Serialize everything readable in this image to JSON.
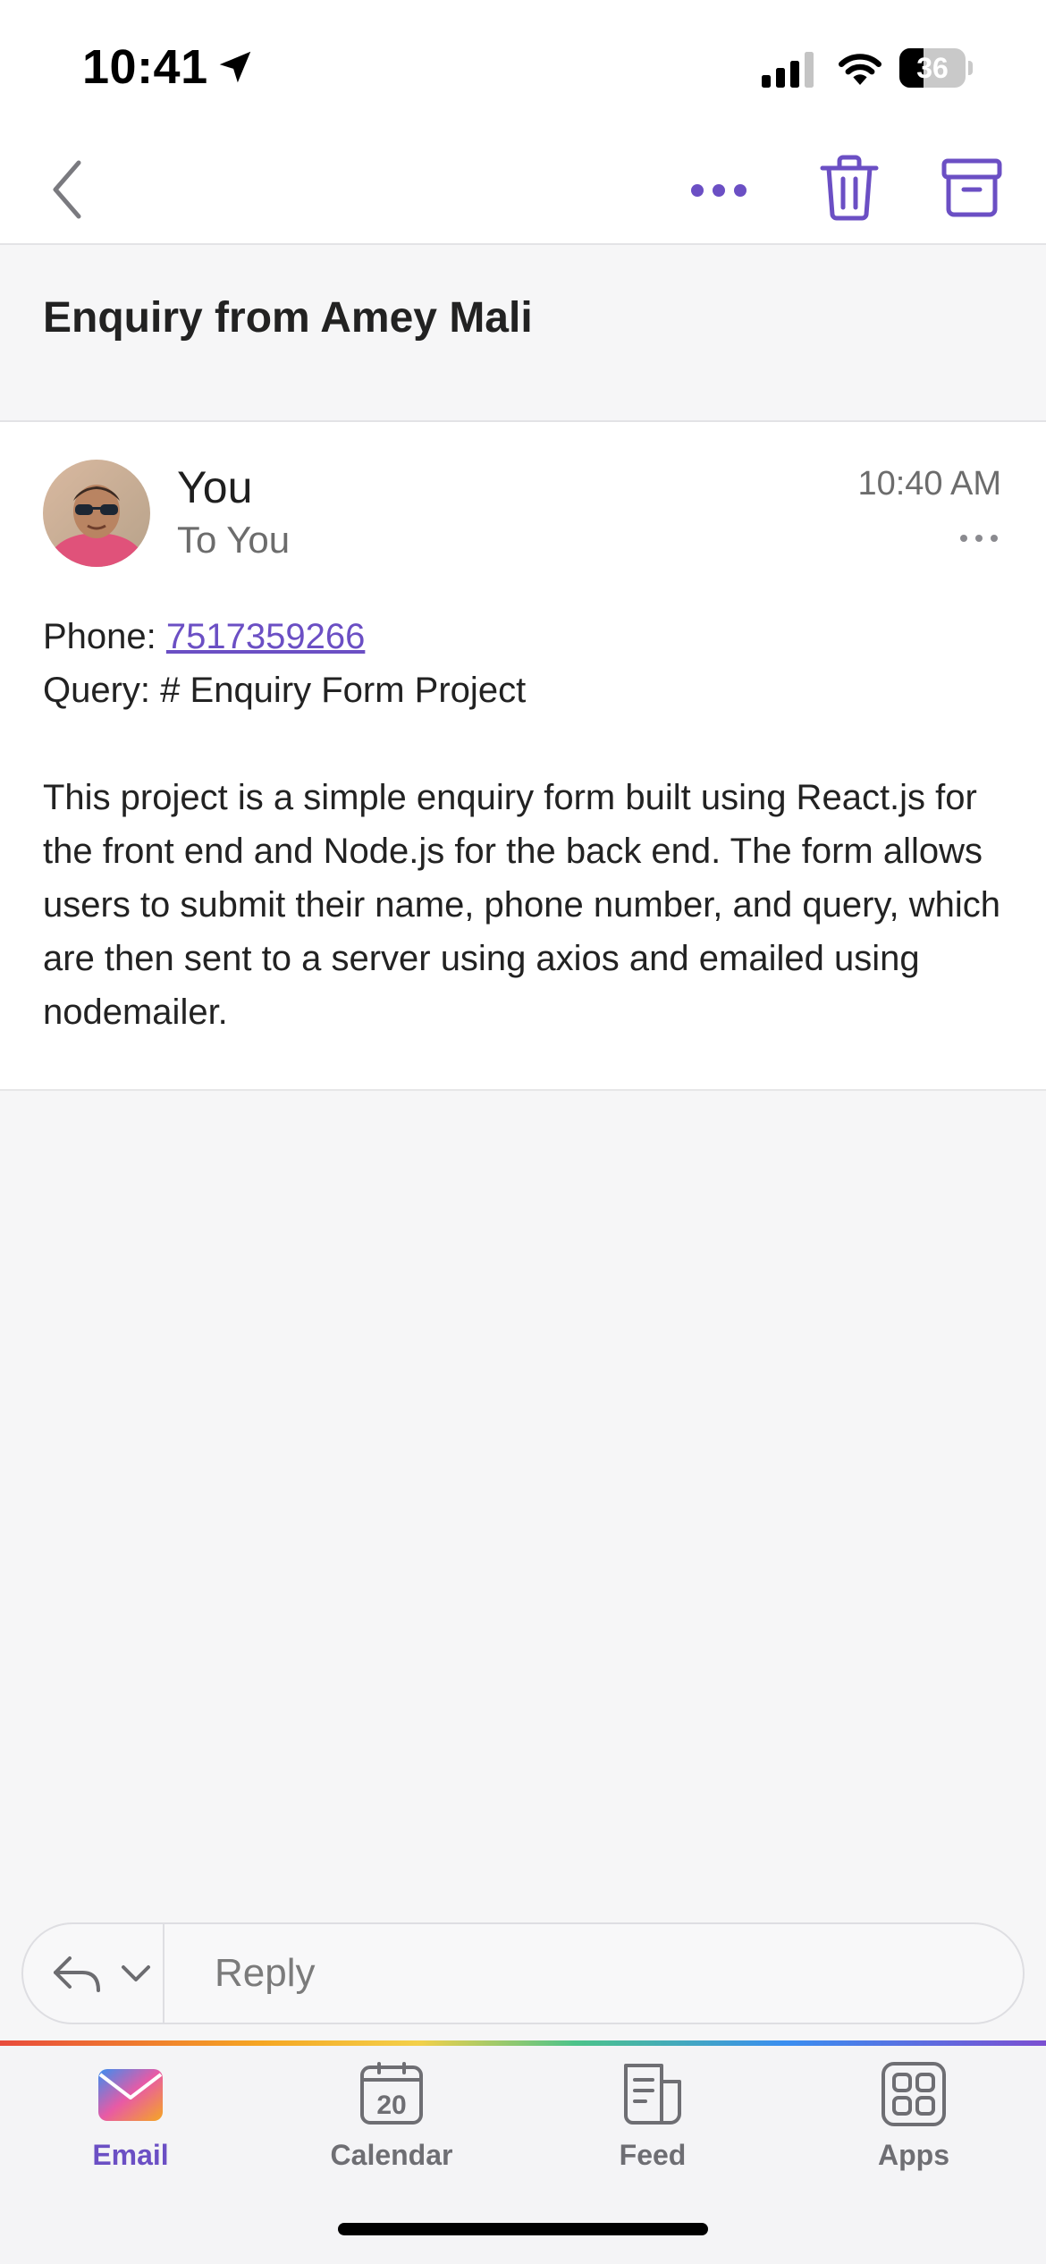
{
  "status_bar": {
    "time": "10:41",
    "battery": "36",
    "battery_level": 0.36
  },
  "toolbar": {
    "icons": [
      "chevron-left-icon",
      "more-horizontal-icon",
      "trash-icon",
      "archive-icon"
    ],
    "accent_color": "#6b4fc4"
  },
  "subject": "Enquiry from Amey Mali",
  "message": {
    "sender": "You",
    "recipient": "To You",
    "time": "10:40 AM",
    "phone_label": "Phone: ",
    "phone_number": "7517359266",
    "query_line": "Query: # Enquiry Form Project",
    "paragraph": "This project is a simple enquiry form built using React.js for the front end and Node.js for the back end. The form allows users to submit their name, phone number, and query, which are then sent to a server using axios and emailed using nodemailer."
  },
  "reply": {
    "placeholder": "Reply"
  },
  "tabs": [
    {
      "label": "Email",
      "icon": "email-icon",
      "active": true
    },
    {
      "label": "Calendar",
      "icon": "calendar-icon",
      "day": "20",
      "active": false
    },
    {
      "label": "Feed",
      "icon": "feed-icon",
      "active": false
    },
    {
      "label": "Apps",
      "icon": "apps-icon",
      "active": false
    }
  ],
  "colors": {
    "accent": "#6b4fc4",
    "background": "#f6f6f7",
    "muted_text": "#6c6c6c"
  }
}
